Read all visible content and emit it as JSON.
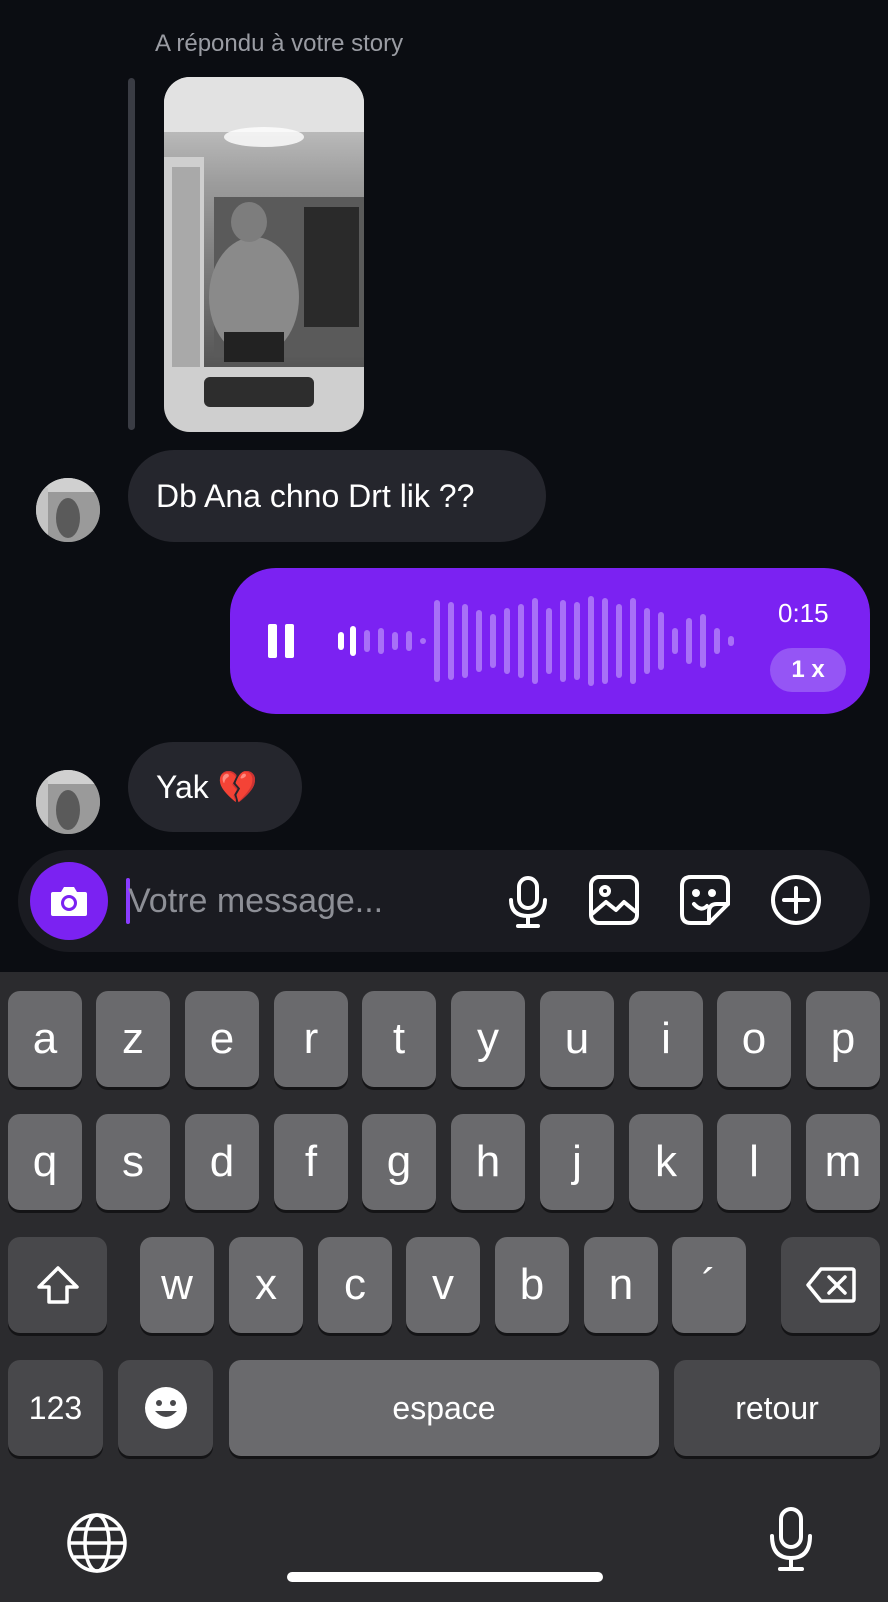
{
  "story": {
    "caption": "A répondu à votre story"
  },
  "messages": {
    "incoming_1": "Db Ana chno Drt lik ??",
    "voice": {
      "duration": "0:15",
      "speed": "1 x"
    },
    "incoming_2": "Yak 💔"
  },
  "composer": {
    "placeholder": "Votre message..."
  },
  "keyboard": {
    "row1": [
      "a",
      "z",
      "e",
      "r",
      "t",
      "y",
      "u",
      "i",
      "o",
      "p"
    ],
    "row2": [
      "q",
      "s",
      "d",
      "f",
      "g",
      "h",
      "j",
      "k",
      "l",
      "m"
    ],
    "row3": [
      "w",
      "x",
      "c",
      "v",
      "b",
      "n",
      "´"
    ],
    "numbers_label": "123",
    "space_label": "espace",
    "return_label": "retour"
  },
  "colors": {
    "accent": "#7b22f2",
    "background": "#0b0d12",
    "bubble": "#25262d"
  }
}
